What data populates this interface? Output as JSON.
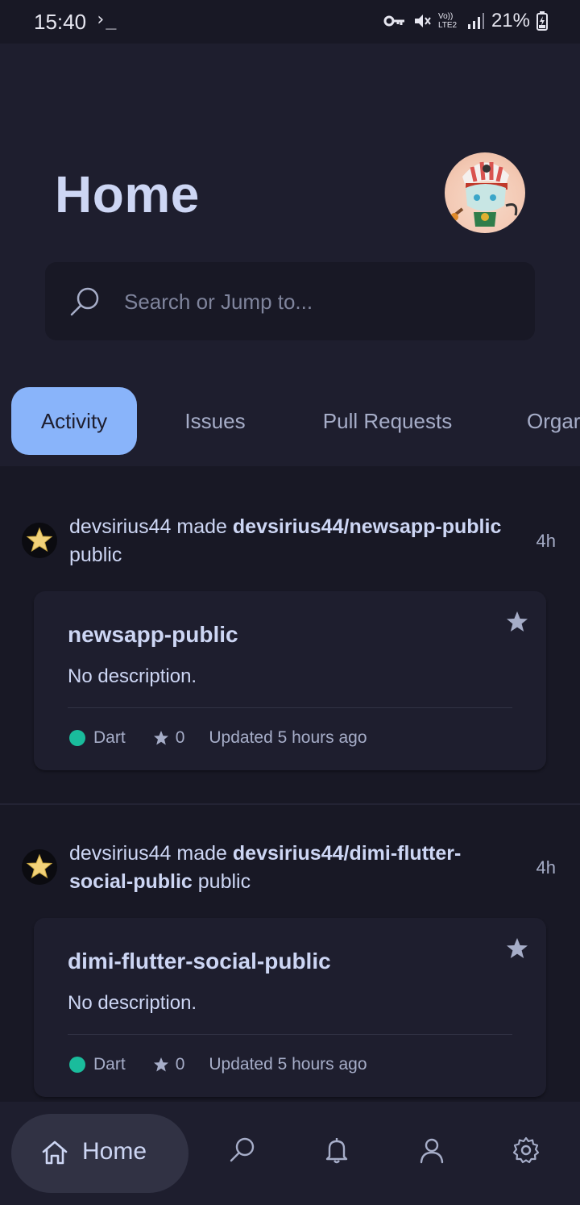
{
  "status_bar": {
    "time": "15:40",
    "terminal_glyph": "›_",
    "network_label": "Vo)) LTE2",
    "battery": "21%"
  },
  "header": {
    "title": "Home",
    "search_placeholder": "Search or Jump to..."
  },
  "tabs": [
    {
      "label": "Activity",
      "active": true
    },
    {
      "label": "Issues",
      "active": false
    },
    {
      "label": "Pull Requests",
      "active": false
    },
    {
      "label": "Orgar",
      "active": false
    }
  ],
  "feed": [
    {
      "actor": "devsirius44",
      "verb": "made",
      "repo_full": "devsirius44/newsapp-public",
      "suffix": "public",
      "time_ago": "4h",
      "repo_name": "newsapp-public",
      "description": "No description.",
      "language": "Dart",
      "language_color": "#1abc9c",
      "stars": "0",
      "updated": "Updated 5 hours ago"
    },
    {
      "actor": "devsirius44",
      "verb": "made",
      "repo_full": "devsirius44/dimi-flutter-social-public",
      "suffix": "public",
      "time_ago": "4h",
      "repo_name": "dimi-flutter-social-public",
      "description": "No description.",
      "language": "Dart",
      "language_color": "#1abc9c",
      "stars": "0",
      "updated": "Updated 5 hours ago"
    }
  ],
  "bottom_nav": {
    "home_label": "Home"
  },
  "colors": {
    "background": "#1e1e2e",
    "surface": "#181825",
    "accent": "#89b4fa",
    "text": "#cdd6f4",
    "muted": "#a6adc8"
  }
}
